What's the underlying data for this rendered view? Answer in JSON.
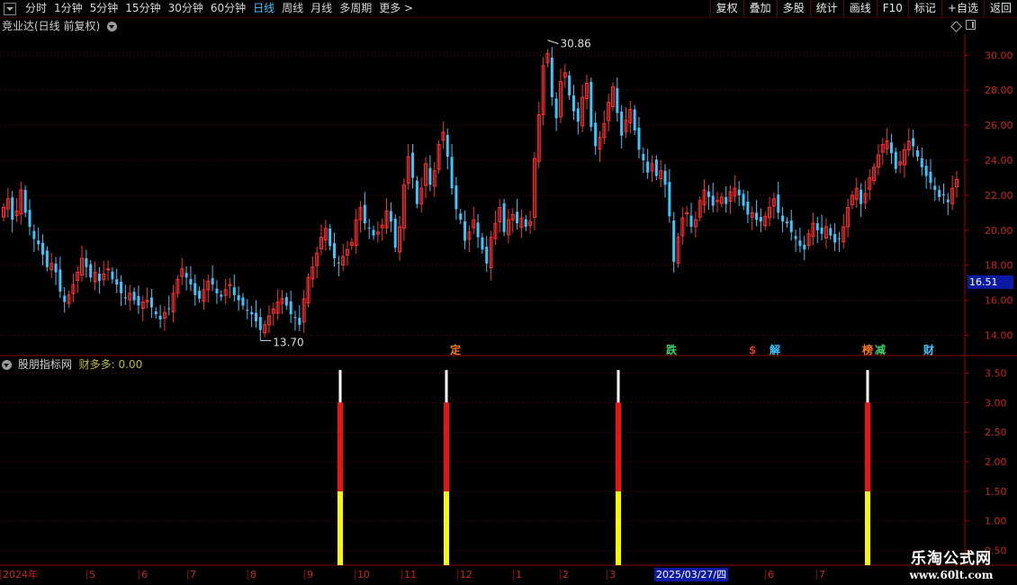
{
  "toolbar": {
    "periods": [
      "分时",
      "1分钟",
      "5分钟",
      "15分钟",
      "30分钟",
      "60分钟",
      "日线",
      "周线",
      "月线",
      "多周期",
      "更多 >"
    ],
    "active_period": "日线",
    "actions": [
      "复权",
      "叠加",
      "多股",
      "统计",
      "画线",
      "F10",
      "+自选",
      "返回",
      "标记"
    ]
  },
  "main": {
    "title": "竞业达(日线 前复权)",
    "high_label": "30.86",
    "low_label": "13.70",
    "price_tag": "16.51",
    "y_ticks": [
      "30.00",
      "28.00",
      "26.00",
      "24.00",
      "22.00",
      "20.00",
      "18.00",
      "16.00",
      "14.00"
    ],
    "markers": [
      {
        "text": "定",
        "color": "#ff7a1a"
      },
      {
        "text": "跌",
        "color": "#39d16b"
      },
      {
        "text": "$",
        "color": "#e03030"
      },
      {
        "text": "解",
        "color": "#39c7ff"
      },
      {
        "text": "榜",
        "color": "#ff7a1a"
      },
      {
        "text": "减",
        "color": "#39d16b"
      },
      {
        "text": "财",
        "color": "#39c7ff"
      }
    ]
  },
  "sub": {
    "name": "股朋指标网",
    "value_label": "财多多: 0.00",
    "y_ticks": [
      "3.50",
      "3.00",
      "2.50",
      "2.00",
      "1.50",
      "1.00",
      "0.50"
    ]
  },
  "dates": {
    "labels": [
      "2024年",
      "5",
      "6",
      "7",
      "8",
      "9",
      "10",
      "11",
      "12",
      "1",
      "2",
      "3",
      "6",
      "7"
    ],
    "highlight": "2025/03/27/四"
  },
  "watermark": {
    "line1": "乐淘公式网",
    "line2": "www.60lt.com"
  },
  "colors": {
    "up": "#ff3030",
    "down": "#39c7ff",
    "grid": "#5a0000",
    "axis": "#a80000",
    "signal_yellow": "#f7f700",
    "signal_red": "#ee1111",
    "signal_white": "#ffffff"
  },
  "chart_data": {
    "type": "candlestick",
    "y_range": [
      13.0,
      31.2
    ],
    "closes": [
      21.3,
      21.8,
      20.6,
      21.1,
      22.3,
      21.0,
      20.2,
      19.5,
      19.2,
      18.6,
      17.9,
      18.1,
      17.6,
      16.5,
      15.9,
      16.3,
      16.9,
      17.6,
      18.4,
      17.9,
      17.3,
      17.6,
      17.1,
      17.5,
      17.8,
      17.2,
      16.9,
      16.4,
      16.1,
      16.4,
      16.0,
      15.7,
      15.9,
      16.0,
      15.6,
      15.2,
      14.9,
      15.3,
      15.5,
      16.4,
      17.2,
      17.8,
      17.3,
      16.9,
      16.3,
      16.1,
      16.6,
      17.1,
      16.9,
      16.4,
      16.2,
      16.6,
      16.9,
      16.3,
      16.0,
      15.7,
      15.4,
      15.2,
      14.8,
      14.3,
      14.6,
      15.1,
      15.5,
      15.9,
      16.1,
      15.7,
      15.2,
      15.0,
      14.6,
      16.1,
      17.3,
      17.9,
      18.7,
      19.6,
      20.1,
      19.1,
      18.4,
      18.1,
      18.5,
      18.9,
      19.3,
      20.6,
      21.3,
      20.4,
      20.1,
      19.7,
      19.9,
      20.3,
      21.1,
      20.5,
      19.0,
      20.2,
      22.6,
      24.2,
      23.0,
      21.5,
      22.4,
      23.8,
      22.6,
      23.4,
      24.9,
      25.6,
      24.2,
      22.4,
      21.2,
      20.6,
      19.4,
      19.9,
      20.6,
      19.6,
      18.9,
      18.1,
      19.6,
      20.4,
      21.3,
      19.9,
      20.6,
      20.9,
      20.4,
      20.7,
      20.2,
      20.5,
      24.1,
      26.6,
      29.4,
      30.1,
      27.6,
      26.4,
      28.5,
      29.0,
      27.7,
      26.8,
      26.2,
      27.6,
      28.4,
      25.9,
      24.8,
      25.3,
      26.1,
      27.3,
      28.2,
      26.7,
      25.4,
      26.3,
      26.9,
      25.7,
      24.6,
      24.0,
      23.3,
      23.8,
      23.1,
      23.4,
      22.6,
      20.8,
      18.2,
      19.6,
      20.7,
      21.0,
      20.2,
      20.6,
      21.7,
      22.3,
      21.9,
      21.4,
      21.7,
      21.9,
      21.5,
      22.2,
      22.4,
      22.0,
      21.4,
      20.9,
      21.0,
      20.6,
      20.5,
      20.8,
      21.3,
      21.8,
      21.0,
      20.5,
      20.4,
      19.9,
      19.5,
      19.1,
      18.9,
      19.8,
      20.4,
      20.0,
      19.8,
      20.2,
      19.7,
      19.3,
      19.5,
      20.2,
      21.3,
      22.0,
      22.4,
      21.5,
      22.1,
      23.0,
      23.6,
      24.3,
      24.9,
      25.1,
      24.4,
      23.5,
      23.9,
      24.6,
      25.1,
      24.8,
      24.2,
      23.6,
      23.1,
      22.7,
      22.3,
      21.9,
      22.0,
      21.6,
      22.4,
      22.9
    ]
  }
}
